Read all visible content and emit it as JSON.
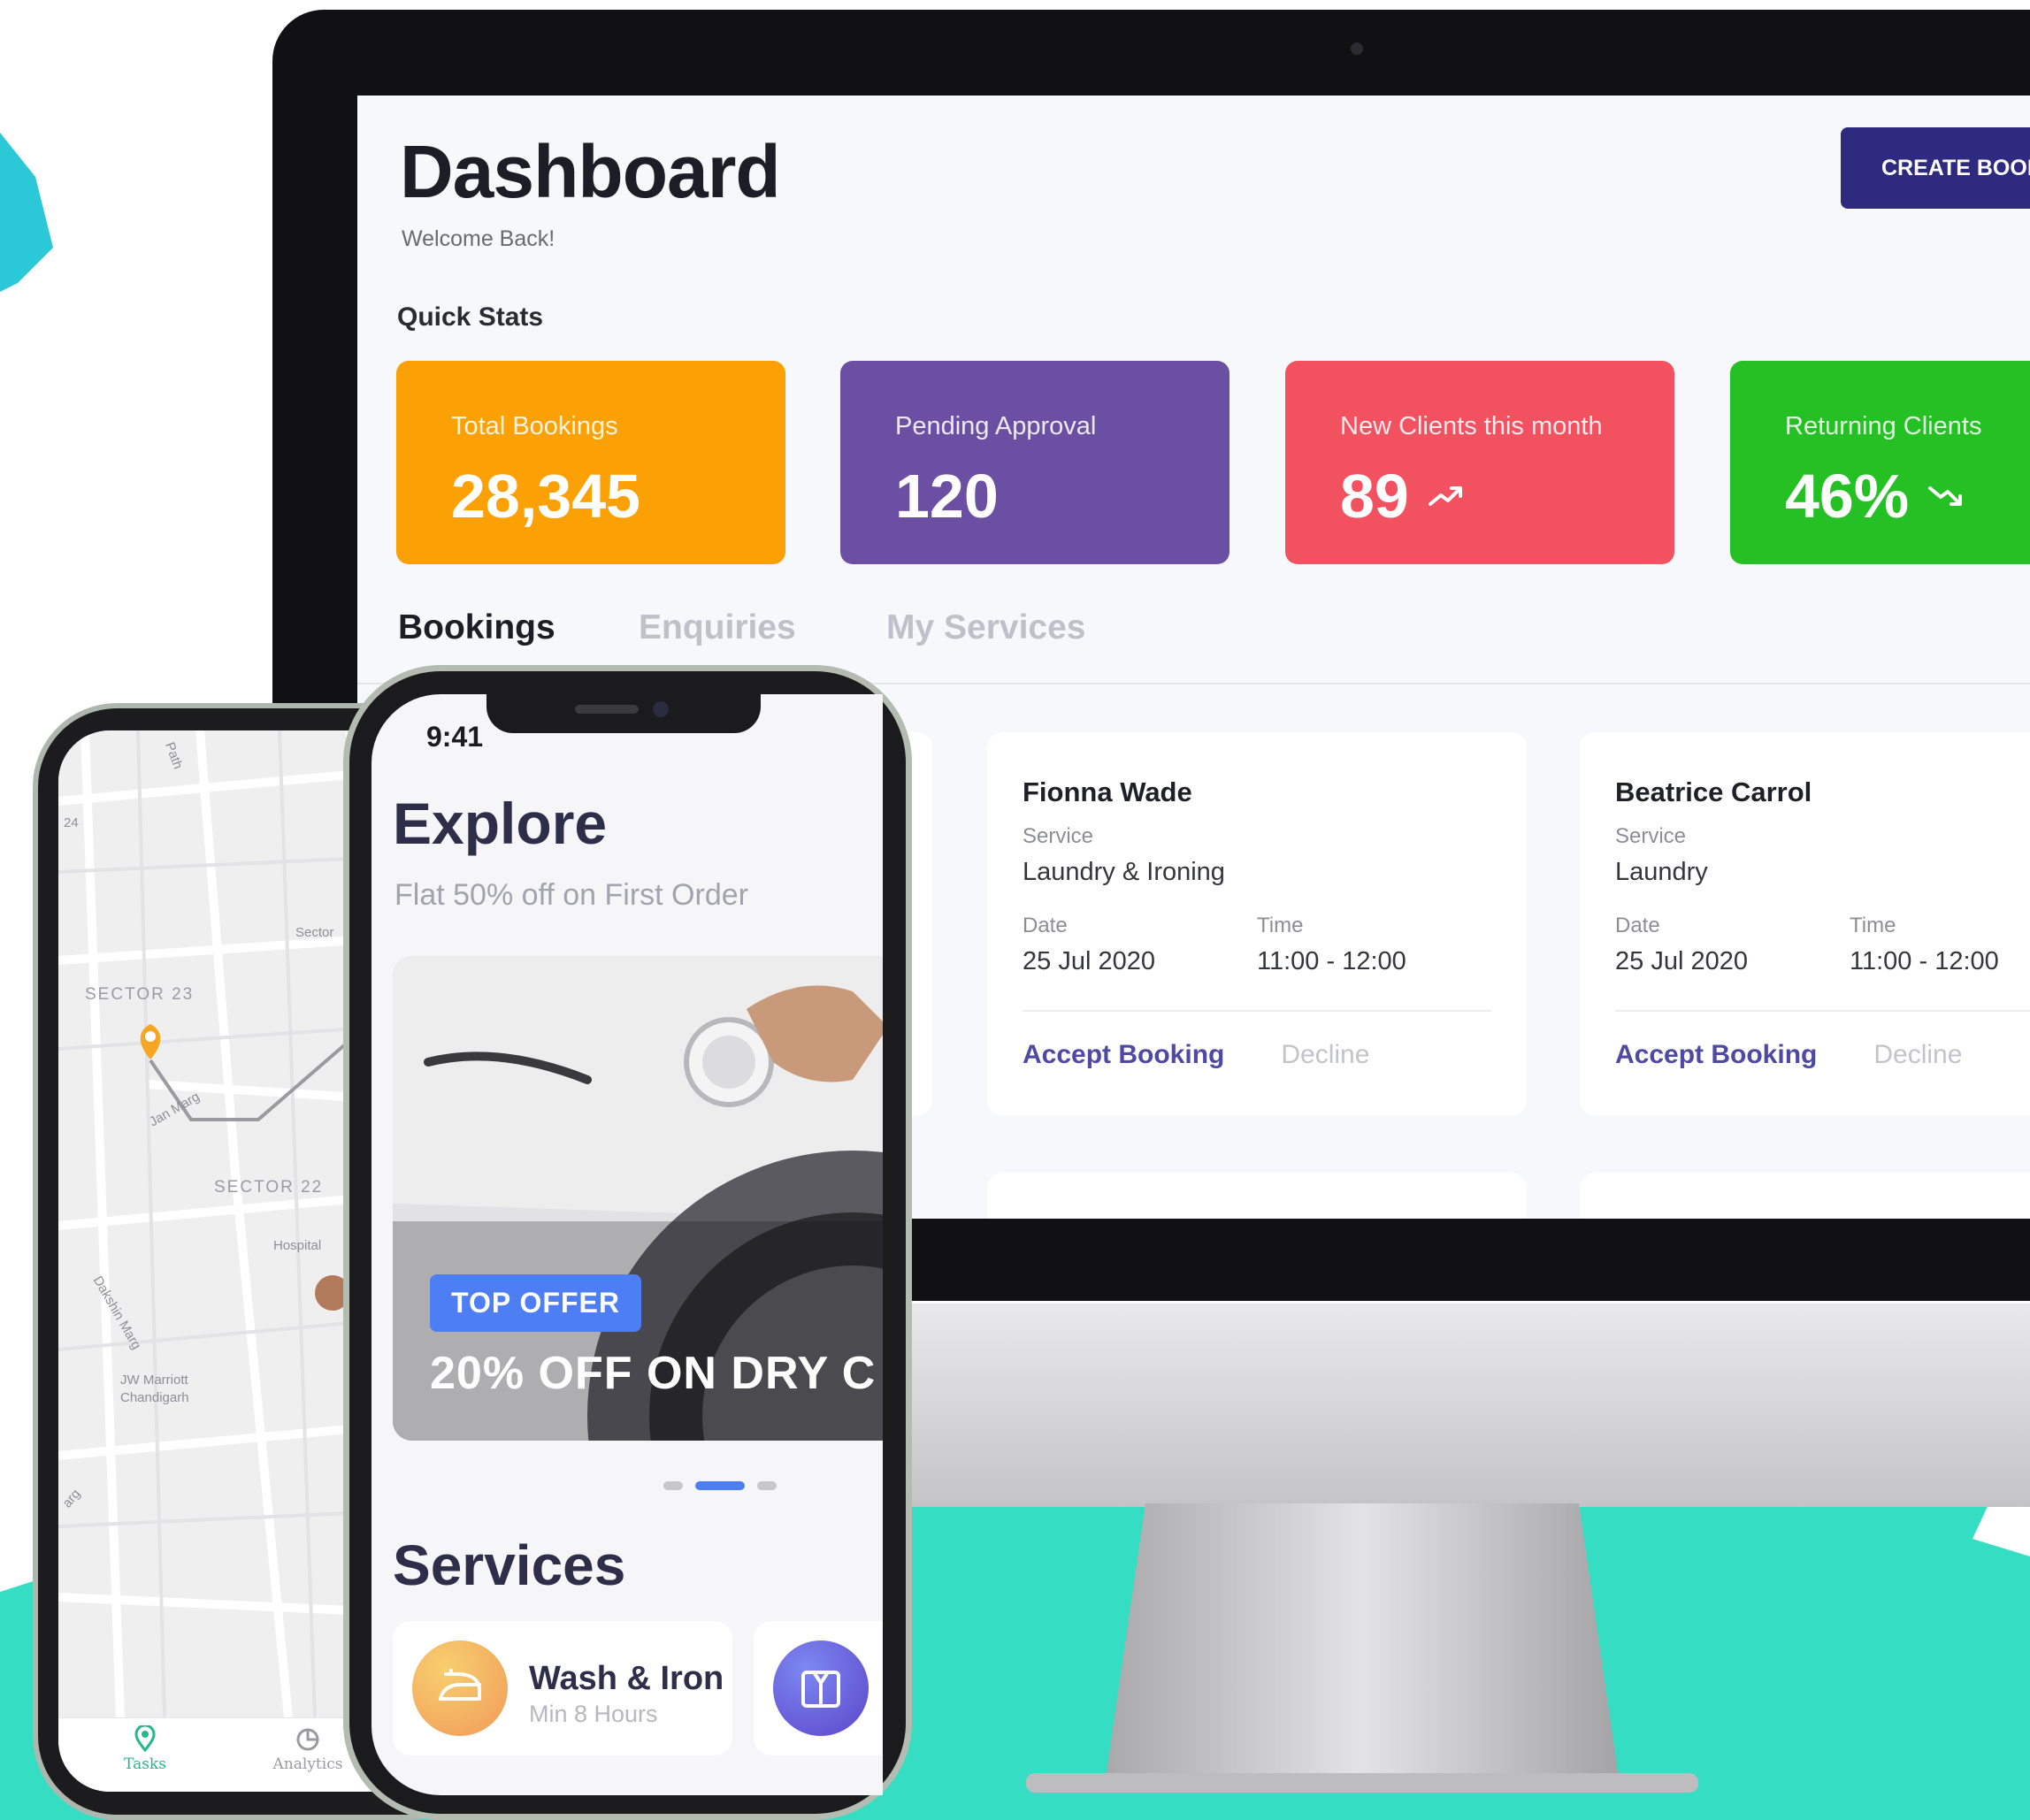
{
  "colors": {
    "teal_background": "#35dec2",
    "accent_indigo": "#2d2a7f",
    "card_orange": "#fba005",
    "card_purple": "#6a4fa2",
    "card_red": "#f2515f",
    "card_green": "#25c124",
    "offer_blue": "#4d7ef3"
  },
  "dashboard": {
    "title": "Dashboard",
    "subtitle": "Welcome Back!",
    "create_button": "CREATE BOOK",
    "quick_stats_label": "Quick Stats",
    "stats": [
      {
        "label": "Total Bookings",
        "value": "28,345",
        "color": "#fba005"
      },
      {
        "label": "Pending Approval",
        "value": "120",
        "color": "#6a4fa2"
      },
      {
        "label": "New Clients this month",
        "value": "89",
        "trend_icon": "trending-up-icon",
        "color": "#f2515f"
      },
      {
        "label": "Returning Clients",
        "value": "46%",
        "trend_icon": "trending-down-icon",
        "color": "#25c124"
      }
    ],
    "tabs": [
      {
        "label": "Bookings",
        "active": true
      },
      {
        "label": "Enquiries",
        "active": false
      },
      {
        "label": "My Services",
        "active": false
      }
    ],
    "bookings": [
      {
        "name": "Fionna Wade",
        "service_label": "Service",
        "service": "Laundry & Ironing",
        "date_label": "Date",
        "date": "25 Jul 2020",
        "time_label": "Time",
        "time": "11:00 - 12:00",
        "accept": "Accept Booking",
        "decline": "Decline"
      },
      {
        "name": "Beatrice Carrol",
        "service_label": "Service",
        "service": "Laundry",
        "date_label": "Date",
        "date": "25 Jul 2020",
        "time_label": "Time",
        "time": "11:00 - 12:00",
        "accept": "Accept Booking",
        "decline": "Decline"
      }
    ]
  },
  "map_phone": {
    "labels": {
      "sector23": "SECTOR 23",
      "sector22": "SECTOR 22",
      "sector_partial": "Sector",
      "hospital": "Hospital",
      "jan_marg": "Jan Marg",
      "dakshin_marg": "Dakshin Marg",
      "jw_marriott": "JW Marriott",
      "chandigarh": "Chandigarh",
      "path": "Path",
      "num24": "24",
      "arg": "arg"
    },
    "tabbar": [
      {
        "label": "Tasks",
        "icon": "location-pin-icon",
        "active": true
      },
      {
        "label": "Analytics",
        "icon": "pie-chart-icon",
        "active": false
      }
    ]
  },
  "explore_phone": {
    "time": "9:41",
    "title": "Explore",
    "subtitle": "Flat 50% off on First Order",
    "banner": {
      "badge": "TOP OFFER",
      "text": "20% OFF ON DRY C"
    },
    "services_title": "Services",
    "services": [
      {
        "name": "Wash & Iron",
        "meta": "Min 8 Hours",
        "icon": "iron-icon"
      },
      {
        "icon": "shirt-icon"
      }
    ]
  }
}
